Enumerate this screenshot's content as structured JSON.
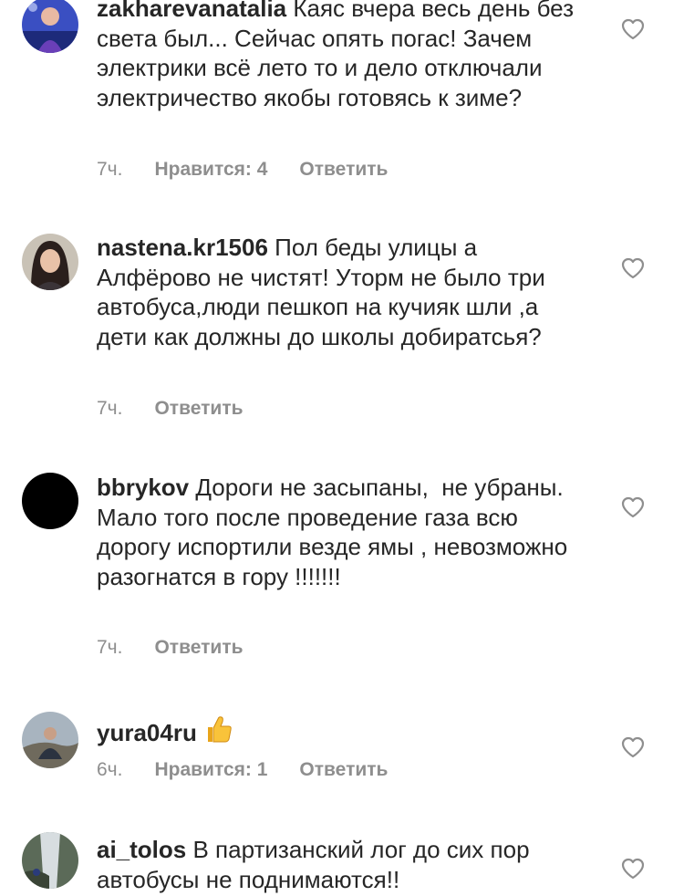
{
  "comments": [
    {
      "username": "zakharevanatalia",
      "text": "Каяс вчера весь день без света был... Сейчас опять погас! Зачем электрики всё лето то и дело отключали электричество якобы готовясь к зиме?",
      "time": "7ч.",
      "likes": "Нравится: 4",
      "reply": "Ответить"
    },
    {
      "username": "nastena.kr1506",
      "text": "Пол беды улицы а Алфёрово не чистят! Уторм не было три автобуса,люди пешкоп на кучияк шли ,а дети как должны до школы добиратсья?",
      "time": "7ч.",
      "reply": "Ответить"
    },
    {
      "username": "bbrykov",
      "text": "Дороги не засыпаны,  не убраны. Мало того после проведение газа всю дорогу испортили везде ямы , невозможно разогнатся в гору !!!!!!!",
      "time": "7ч.",
      "reply": "Ответить"
    },
    {
      "username": "yura04ru",
      "text": "",
      "emoji": "thumbs-up-emoji",
      "time": "6ч.",
      "likes": "Нравится: 1",
      "reply": "Ответить"
    },
    {
      "username": "ai_tolos",
      "text": "В партизанский лог до сих пор автобусы не поднимаются!!"
    }
  ],
  "icons": {
    "like": "heart-outline-icon"
  },
  "colors": {
    "text": "#262626",
    "meta": "#8e8e8e",
    "heart_stroke": "#8e8e8e"
  }
}
